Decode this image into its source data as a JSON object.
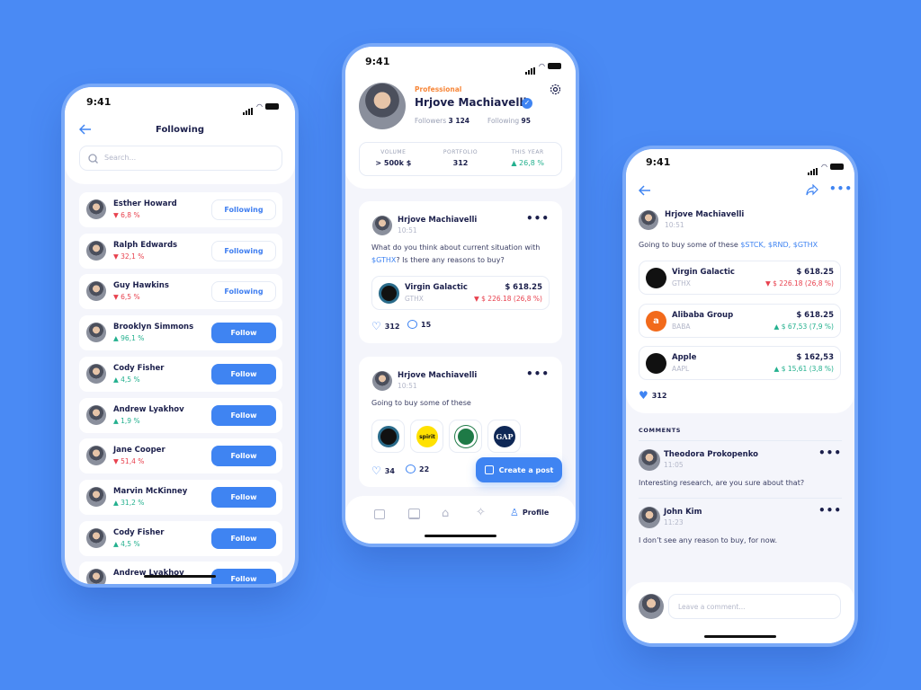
{
  "status_time": "9:41",
  "colors": {
    "background": "#4a8af4",
    "accent": "#3f84f2",
    "down": "#e8414e",
    "up": "#23b08e",
    "badge": "#f7873a"
  },
  "following_screen": {
    "title": "Following",
    "search_placeholder": "Search...",
    "users": [
      {
        "name": "Esther Howard",
        "change": "6,8 %",
        "trend": "down",
        "button": "Following"
      },
      {
        "name": "Ralph Edwards",
        "change": "32,1 %",
        "trend": "down",
        "button": "Following"
      },
      {
        "name": "Guy Hawkins",
        "change": "6,5 %",
        "trend": "down",
        "button": "Following"
      },
      {
        "name": "Brooklyn Simmons",
        "change": "96,1 %",
        "trend": "up",
        "button": "Follow"
      },
      {
        "name": "Cody Fisher",
        "change": "4,5 %",
        "trend": "up",
        "button": "Follow"
      },
      {
        "name": "Andrew Lyakhov",
        "change": "1,9 %",
        "trend": "up",
        "button": "Follow"
      },
      {
        "name": "Jane Cooper",
        "change": "51,4 %",
        "trend": "down",
        "button": "Follow"
      },
      {
        "name": "Marvin McKinney",
        "change": "31,2 %",
        "trend": "up",
        "button": "Follow"
      },
      {
        "name": "Cody Fisher",
        "change": "4,5 %",
        "trend": "up",
        "button": "Follow"
      },
      {
        "name": "Andrew Lyakhov",
        "change": "",
        "trend": "up",
        "button": "Follow"
      }
    ]
  },
  "profile_screen": {
    "badge": "Professional",
    "name": "Hrjove Machiavelli",
    "followers_label": "Followers",
    "followers": "3 124",
    "following_label": "Following",
    "following": "95",
    "stats": [
      {
        "label": "VOLUME",
        "value": "> 500k $"
      },
      {
        "label": "PORTFOLIO",
        "value": "312"
      },
      {
        "label": "THIS YEAR",
        "value": "26,8 %"
      }
    ],
    "posts": [
      {
        "author": "Hrjove Machiavelli",
        "time": "10:51",
        "text_a": "What do you think about current situation with ",
        "tag": "$GTHX",
        "text_b": "? Is there any reasons to buy?",
        "stock": {
          "name": "Virgin Galactic",
          "ticker": "GTHX",
          "price": "$ 618.25",
          "change": "$ 226.18 (26,8 %)"
        },
        "likes": "312",
        "comments": "15"
      },
      {
        "author": "Hrjove Machiavelli",
        "time": "10:51",
        "text": "Going to buy some of these",
        "logos": [
          "Virgin Galactic",
          "spirit",
          "Starbucks",
          "GAP"
        ],
        "likes": "34",
        "comments": "22"
      }
    ],
    "create_post": "Create a post",
    "nav": {
      "active_label": "Profile"
    }
  },
  "post_screen": {
    "author": "Hrjove Machiavelli",
    "time": "10:51",
    "text": "Going to buy some of these ",
    "tags": "$STCK, $RND, $GTHX",
    "stocks": [
      {
        "name": "Virgin Galactic",
        "ticker": "GTHX",
        "price": "$ 618.25",
        "change": "$ 226.18 (26,8 %)",
        "trend": "down"
      },
      {
        "name": "Alibaba Group",
        "ticker": "BABA",
        "price": "$ 618.25",
        "change": "$ 67,53 (7,9 %)",
        "trend": "up"
      },
      {
        "name": "Apple",
        "ticker": "AAPL",
        "price": "$ 162,53",
        "change": "$ 15,61 (3,8 %)",
        "trend": "up"
      }
    ],
    "likes": "312",
    "comments_title": "COMMENTS",
    "comments": [
      {
        "author": "Theodora Prokopenko",
        "time": "11:05",
        "text": "Interesting research, are you sure about that?"
      },
      {
        "author": "John Kim",
        "time": "11:23",
        "text": "I don’t see any reason to buy, for now."
      }
    ],
    "comment_placeholder": "Leave a comment..."
  }
}
